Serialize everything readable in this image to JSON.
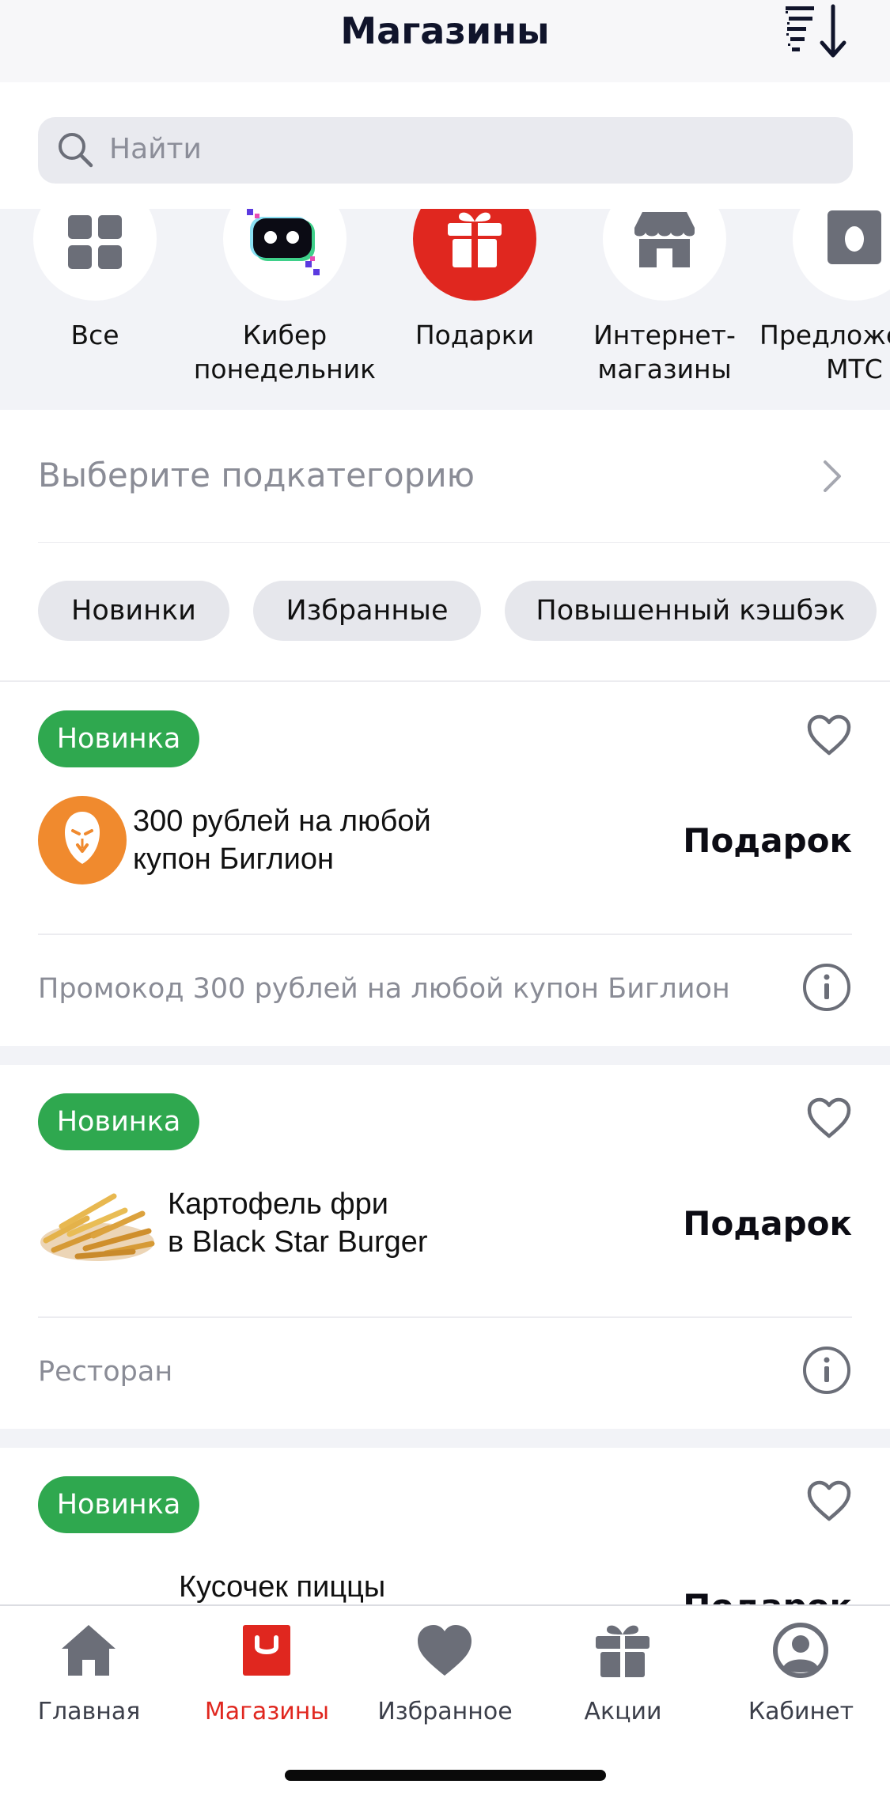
{
  "header": {
    "title": "Магазины",
    "sort_icon": "sort-descending-icon"
  },
  "search": {
    "placeholder": "Найти",
    "icon": "search-icon"
  },
  "categories": [
    {
      "label": "Все",
      "icon": "grid-icon",
      "active": false
    },
    {
      "label": "Кибер понедельник",
      "icon": "cyber-monday-icon",
      "active": false
    },
    {
      "label": "Подарки",
      "icon": "gift-icon",
      "active": true
    },
    {
      "label": "Интернет-магазины",
      "icon": "store-icon",
      "active": false
    },
    {
      "label": "Предложения МТС",
      "icon": "mts-icon",
      "active": false
    }
  ],
  "subcategory": {
    "placeholder": "Выберите подкатегорию",
    "icon": "chevron-right-icon"
  },
  "chips": [
    {
      "label": "Новинки"
    },
    {
      "label": "Избранные"
    },
    {
      "label": "Повышенный кэшбэк"
    }
  ],
  "offers": [
    {
      "badge": "Новинка",
      "title_line1": "300 рублей на любой",
      "title_line2": "купон Биглион",
      "reward": "Подарок",
      "description": "Промокод 300 рублей на любой купон Биглион",
      "logo": "biglion-lion-logo"
    },
    {
      "badge": "Новинка",
      "title_line1": "Картофель фри",
      "title_line2": "в Black Star Burger",
      "reward": "Подарок",
      "description": "Ресторан",
      "logo": "french-fries-image"
    },
    {
      "badge": "Новинка",
      "title_line1": "Кусочек пиццы",
      "title_line2": "",
      "reward": "Подарок",
      "description": "",
      "logo": "pizza-slice-image"
    }
  ],
  "tabbar": [
    {
      "label": "Главная",
      "icon": "home-icon",
      "active": false
    },
    {
      "label": "Магазины",
      "icon": "shop-bag-icon",
      "active": true
    },
    {
      "label": "Избранное",
      "icon": "heart-icon",
      "active": false
    },
    {
      "label": "Акции",
      "icon": "gift-icon",
      "active": false
    },
    {
      "label": "Кабинет",
      "icon": "profile-icon",
      "active": false
    }
  ],
  "colors": {
    "accent": "#e0271f",
    "badge_green": "#2fa84f",
    "muted_text": "#8a8c96",
    "icon_gray": "#6b6e78"
  }
}
